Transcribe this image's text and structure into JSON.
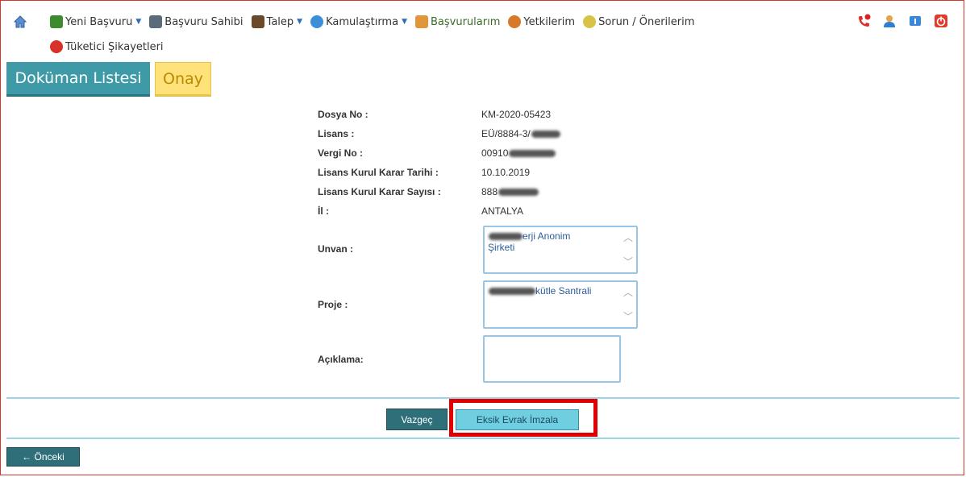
{
  "menu": {
    "items": [
      {
        "label": "Yeni Başvuru",
        "icon": "new-application-icon",
        "color": "#3c8b2e",
        "caret": true
      },
      {
        "label": "Başvuru Sahibi",
        "icon": "applicant-icon",
        "color": "#5b6b7a",
        "caret": false
      },
      {
        "label": "Talep",
        "icon": "request-icon",
        "color": "#6b4a2a",
        "caret": true
      },
      {
        "label": "Kamulaştırma",
        "icon": "globe-icon",
        "color": "#3a8fd8",
        "caret": true
      },
      {
        "label": "Başvurularım",
        "icon": "my-applications-icon",
        "color": "#e2963a",
        "caret": false
      },
      {
        "label": "Yetkilerim",
        "icon": "permissions-icon",
        "color": "#d7792a",
        "caret": false
      },
      {
        "label": "Sorun / Önerilerim",
        "icon": "suggestions-icon",
        "color": "#d8c247",
        "caret": false
      }
    ],
    "second_row": {
      "label": "Tüketici Şikayetleri",
      "icon": "consumer-complaints-icon"
    }
  },
  "tabs": {
    "documents": "Doküman Listesi",
    "approval": "Onay"
  },
  "form": {
    "dosya_no": {
      "label": "Dosya No :",
      "value": "KM-2020-05423"
    },
    "lisans": {
      "label": "Lisans :",
      "value": "EÜ/8884-3/"
    },
    "vergi_no": {
      "label": "Vergi No :",
      "value": "00910"
    },
    "karar_tarihi": {
      "label": "Lisans Kurul Karar Tarihi :",
      "value": "10.10.2019"
    },
    "karar_sayisi": {
      "label": "Lisans Kurul Karar Sayısı :",
      "value": "888"
    },
    "il": {
      "label": "İl :",
      "value": "ANTALYA"
    },
    "unvan": {
      "label": "Unvan :",
      "value_line1": "erji Anonim",
      "value_line2": "Şirketi"
    },
    "proje": {
      "label": "Proje :",
      "value": "kütle Santrali"
    },
    "aciklama": {
      "label": "Açıklama:",
      "value": ""
    }
  },
  "buttons": {
    "cancel": "Vazgeç",
    "sign": "Eksik Evrak İmzala",
    "previous": "← Önceki"
  },
  "colors": {
    "accent": "#3e9aa6",
    "highlight": "#e00000",
    "approval_tab": "#ffe37a"
  }
}
